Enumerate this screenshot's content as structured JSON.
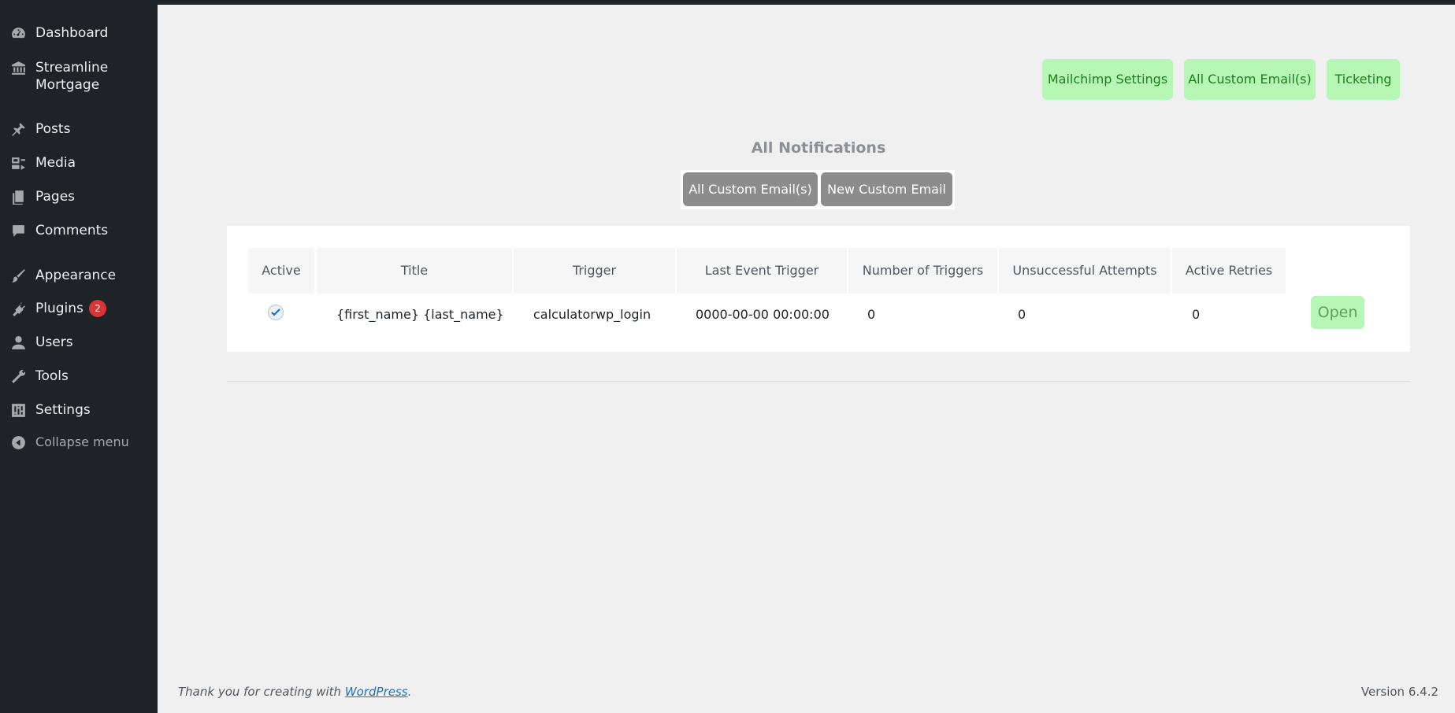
{
  "sidebar": {
    "items": [
      {
        "label": "Dashboard",
        "icon": "dashboard-icon"
      },
      {
        "label": "Streamline Mortgage",
        "icon": "bank-icon"
      },
      {
        "label": "Posts",
        "icon": "pin-icon"
      },
      {
        "label": "Media",
        "icon": "media-icon"
      },
      {
        "label": "Pages",
        "icon": "pages-icon"
      },
      {
        "label": "Comments",
        "icon": "comment-icon"
      },
      {
        "label": "Appearance",
        "icon": "brush-icon"
      },
      {
        "label": "Plugins",
        "icon": "plugin-icon",
        "badge": "2"
      },
      {
        "label": "Users",
        "icon": "user-icon"
      },
      {
        "label": "Tools",
        "icon": "wrench-icon"
      },
      {
        "label": "Settings",
        "icon": "sliders-icon"
      },
      {
        "label": "Collapse menu",
        "icon": "collapse-icon"
      }
    ]
  },
  "top_nav": {
    "mailchimp": "Mailchimp Settings",
    "custom_emails": "All Custom Email(s)",
    "ticketing": "Ticketing"
  },
  "page_title": "All Notifications",
  "tabs": {
    "all": "All Custom Email(s)",
    "new": "New Custom Email"
  },
  "table": {
    "headers": [
      "Active",
      "Title",
      "Trigger",
      "Last Event Trigger",
      "Number of Triggers",
      "Unsuccessful Attempts",
      "Active Retries"
    ],
    "rows": [
      {
        "active": true,
        "title": "{first_name} {last_name}",
        "trigger": "calculatorwp_login",
        "last_event": "0000-00-00 00:00:00",
        "num_triggers": "0",
        "unsuccessful": "0",
        "retries": "0",
        "action": "Open"
      }
    ]
  },
  "footer": {
    "thanks_prefix": "Thank you for creating with ",
    "link": "WordPress",
    "suffix": ".",
    "version": "Version 6.4.2"
  },
  "colors": {
    "sidebar_bg": "#1d2327",
    "page_bg": "#f0f0f1",
    "green_btn": "#b6f7b6",
    "tab_btn": "#8c8c8c",
    "badge": "#d63638"
  }
}
